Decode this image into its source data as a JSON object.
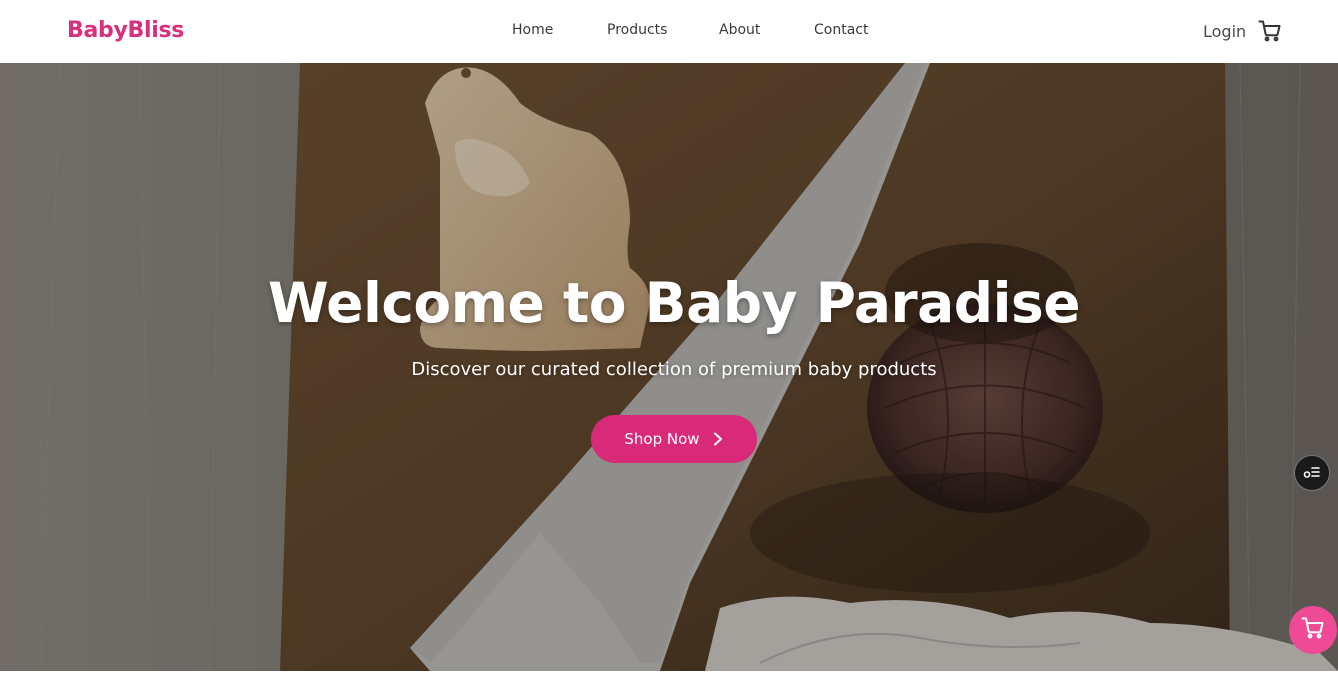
{
  "brand": {
    "name": "BabyBliss",
    "color": "#d6307e"
  },
  "nav": {
    "items": [
      {
        "label": "Home"
      },
      {
        "label": "Products"
      },
      {
        "label": "About"
      },
      {
        "label": "Contact"
      }
    ],
    "login_label": "Login",
    "cart_icon": "cart-icon"
  },
  "hero": {
    "title": "Welcome to Baby Paradise",
    "subtitle": "Discover our curated collection of premium baby products",
    "cta_label": "Shop Now",
    "cta_icon": "chevron-right-icon",
    "cta_color": "#d82a78"
  },
  "floating": {
    "options_icon": "toggle-list-icon",
    "cart_icon": "cart-icon",
    "cart_color": "#ef4a95"
  }
}
